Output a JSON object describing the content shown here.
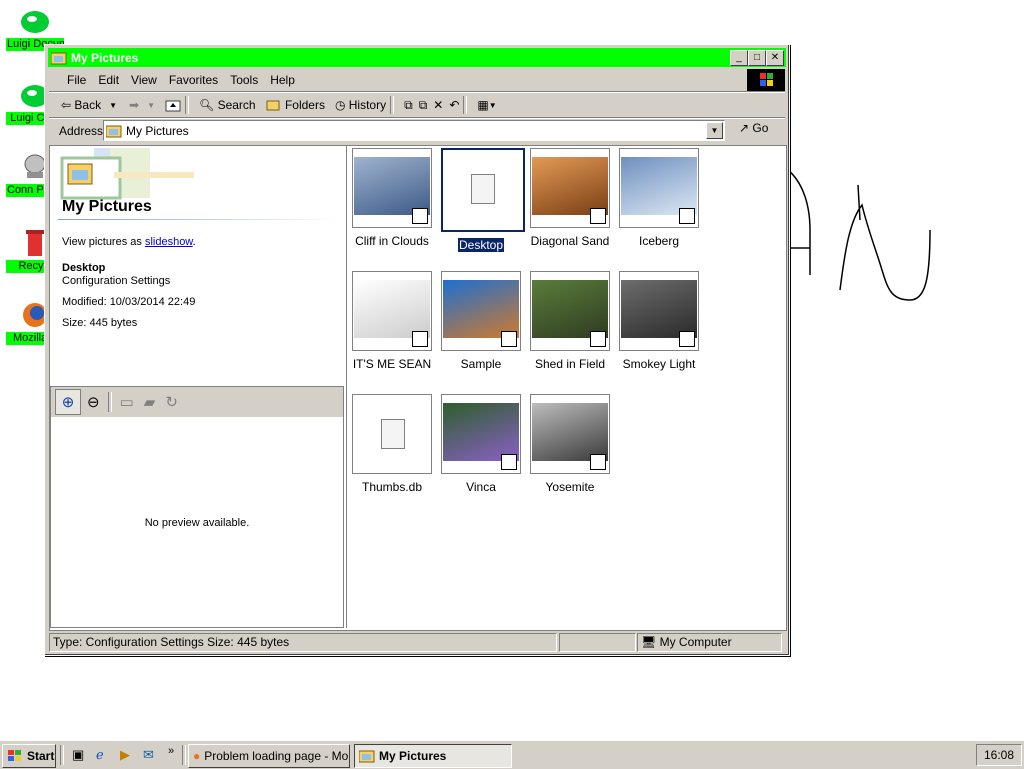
{
  "desktop": {
    "icons": [
      {
        "label": "Luigi Docum",
        "icon": "documents-icon"
      },
      {
        "label": "Luigi Com",
        "icon": "computer-icon"
      },
      {
        "label": "Conn Pre-Se",
        "icon": "connection-icon"
      },
      {
        "label": "Recycl",
        "icon": "recycle-bin-icon"
      },
      {
        "label": "Mozilla F",
        "icon": "firefox-icon"
      }
    ]
  },
  "window": {
    "title": "My Pictures",
    "title_color": "#00ff00",
    "menu": [
      "File",
      "Edit",
      "View",
      "Favorites",
      "Tools",
      "Help"
    ],
    "toolbar": {
      "back": "Back",
      "search": "Search",
      "folders": "Folders",
      "history": "History"
    },
    "address": {
      "label": "Address",
      "value": "My Pictures",
      "go": "Go"
    }
  },
  "left_pane": {
    "heading": "My Pictures",
    "view_prefix": "View pictures as ",
    "view_link": "slideshow",
    "view_suffix": ".",
    "selected_name": "Desktop",
    "selected_type": "Configuration Settings",
    "modified": "Modified: 10/03/2014 22:49",
    "size": "Size: 445 bytes",
    "preview_text": "No preview available."
  },
  "files": [
    {
      "name": "Cliff in Clouds",
      "kind": "photo",
      "colors": [
        "#9fb3cf",
        "#3d5a86"
      ]
    },
    {
      "name": "Desktop",
      "kind": "config",
      "selected": true
    },
    {
      "name": "Diagonal Sand",
      "kind": "photo",
      "colors": [
        "#e39a56",
        "#7a3e14"
      ]
    },
    {
      "name": "Iceberg",
      "kind": "photo",
      "colors": [
        "#6f8fc0",
        "#dce8f4"
      ]
    },
    {
      "name": "IT'S ME SEAN",
      "kind": "photo",
      "colors": [
        "#ffffff",
        "#cccccc"
      ]
    },
    {
      "name": "Sample",
      "kind": "photo",
      "colors": [
        "#1e6fd1",
        "#d07a2c"
      ]
    },
    {
      "name": "Shed in Field",
      "kind": "photo",
      "colors": [
        "#5a7d3a",
        "#2f3b22"
      ]
    },
    {
      "name": "Smokey Light",
      "kind": "photo",
      "colors": [
        "#6d6d6d",
        "#2a2a2a"
      ]
    },
    {
      "name": "Thumbs.db",
      "kind": "file"
    },
    {
      "name": "Vinca",
      "kind": "photo",
      "colors": [
        "#2e5e2a",
        "#8a60c8"
      ]
    },
    {
      "name": "Yosemite",
      "kind": "photo",
      "colors": [
        "#bdbdbd",
        "#3a3a3a"
      ]
    }
  ],
  "status": {
    "left": "Type: Configuration Settings Size: 445 bytes",
    "zone": "My Computer"
  },
  "taskbar": {
    "start": "Start",
    "tasks": [
      {
        "label": "Problem loading page - Mo...",
        "active": false
      },
      {
        "label": "My Pictures",
        "active": true
      }
    ],
    "clock": "16:08"
  }
}
